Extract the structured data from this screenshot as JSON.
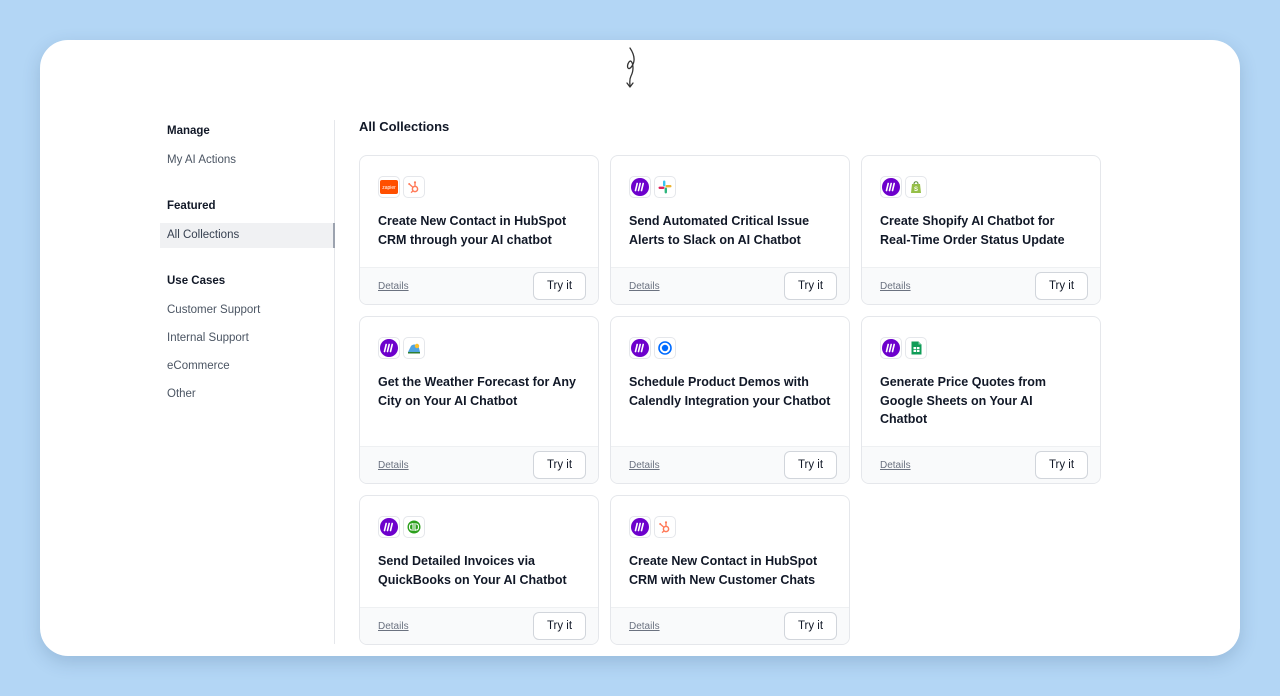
{
  "sidebar": {
    "sections": [
      {
        "heading": "Manage",
        "items": [
          {
            "label": "My AI Actions",
            "active": false
          }
        ]
      },
      {
        "heading": "Featured",
        "items": [
          {
            "label": "All Collections",
            "active": true
          }
        ]
      },
      {
        "heading": "Use Cases",
        "items": [
          {
            "label": "Customer Support",
            "active": false
          },
          {
            "label": "Internal Support",
            "active": false
          },
          {
            "label": "eCommerce",
            "active": false
          },
          {
            "label": "Other",
            "active": false
          }
        ]
      }
    ]
  },
  "main": {
    "title": "All Collections",
    "cards": [
      {
        "title": "Create New Contact in HubSpot CRM through your AI chatbot",
        "icons": [
          "zapier-icon",
          "hubspot-icon"
        ],
        "details_label": "Details",
        "try_label": "Try it"
      },
      {
        "title": "Send Automated Critical Issue Alerts to Slack on AI Chatbot",
        "icons": [
          "make-icon",
          "slack-icon"
        ],
        "details_label": "Details",
        "try_label": "Try it"
      },
      {
        "title": "Create Shopify AI Chatbot for Real-Time Order Status Update",
        "icons": [
          "make-icon",
          "shopify-icon"
        ],
        "details_label": "Details",
        "try_label": "Try it"
      },
      {
        "title": "Get the Weather Forecast for Any City on Your AI Chatbot",
        "icons": [
          "make-icon",
          "weather-icon"
        ],
        "details_label": "Details",
        "try_label": "Try it"
      },
      {
        "title": "Schedule Product Demos with Calendly Integration your Chatbot",
        "icons": [
          "make-icon",
          "calendly-icon"
        ],
        "details_label": "Details",
        "try_label": "Try it"
      },
      {
        "title": "Generate Price Quotes from Google Sheets on Your AI Chatbot",
        "icons": [
          "make-icon",
          "google-sheets-icon"
        ],
        "details_label": "Details",
        "try_label": "Try it"
      },
      {
        "title": "Send Detailed Invoices via QuickBooks on Your AI Chatbot",
        "icons": [
          "make-icon",
          "quickbooks-icon"
        ],
        "details_label": "Details",
        "try_label": "Try it"
      },
      {
        "title": "Create New Contact in HubSpot CRM with New Customer Chats",
        "icons": [
          "make-icon",
          "hubspot-icon"
        ],
        "details_label": "Details",
        "try_label": "Try it"
      }
    ]
  },
  "logo_text": "zapier",
  "colors": {
    "page_background": "#b3d6f5",
    "make_purple": "#6d00cc",
    "zapier_orange": "#ff4f00",
    "hubspot_orange": "#ff7a59",
    "shopify_green": "#95bf47",
    "sheets_green": "#0f9d58",
    "quickbooks_green": "#2ca01c",
    "calendly_blue": "#006bff"
  }
}
